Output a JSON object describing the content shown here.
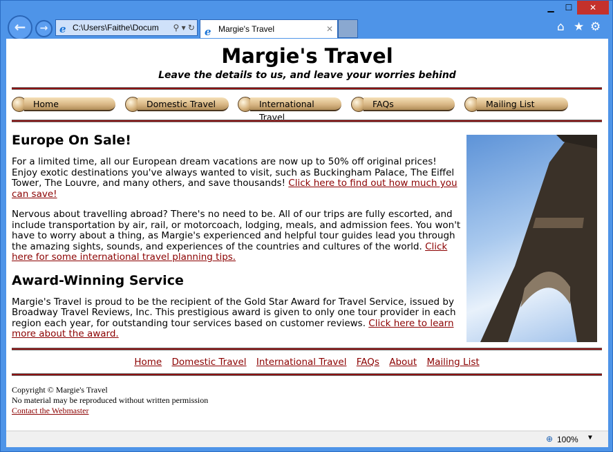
{
  "browser": {
    "address": "C:\\Users\\Faithe\\Docum",
    "tab_title": "Margie's Travel",
    "zoom": "100%"
  },
  "header": {
    "title": "Margie's Travel",
    "tagline": "Leave the details to us, and leave your worries behind"
  },
  "nav": [
    "Home",
    "Domestic Travel",
    "International Travel",
    "FAQs",
    "Mailing List"
  ],
  "sections": [
    {
      "heading": "Europe On Sale!",
      "paragraphs": [
        {
          "text": "For a limited time, all our European dream vacations are now up to 50% off original prices! Enjoy exotic destinations you've always wanted to visit, such as Buckingham Palace, The Eiffel Tower, The Louvre, and many others, and save thousands! ",
          "link": "Click here to find out how much you can save!"
        },
        {
          "text": "Nervous about travelling abroad? There's no need to be. All of our trips are fully escorted, and include transportation by air, rail, or motorcoach, lodging, meals, and admission fees. You won't have to worry about a thing, as Margie's experienced and helpful tour guides lead you through the amazing sights, sounds, and experiences of the countries and cultures of the world. ",
          "link": "Click here for some international travel planning tips."
        }
      ]
    },
    {
      "heading": "Award-Winning Service",
      "paragraphs": [
        {
          "text": "Margie's Travel is proud to be the recipient of the Gold Star Award for Travel Service, issued by Broadway Travel Reviews, Inc. This prestigious award is given to only one tour provider in each region each year, for outstanding tour services based on customer reviews. ",
          "link": "Click here to learn more about the award."
        }
      ]
    }
  ],
  "footer_nav": [
    "Home",
    "Domestic Travel",
    "International Travel",
    "FAQs",
    "About",
    "Mailing List"
  ],
  "footer": {
    "copyright": "Copyright © Margie's Travel",
    "notice": "No material may be reproduced without written permission",
    "contact": "Contact the Webmaster"
  }
}
